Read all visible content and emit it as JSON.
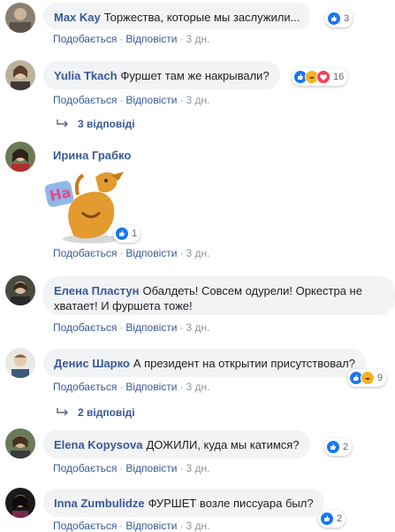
{
  "comments": [
    {
      "name": "Max Kay",
      "text": "Торжества, которые мы заслужили...",
      "reaction_count": "3",
      "actions": {
        "like": "Подобається",
        "reply": "Відповісти",
        "time": "3 дн."
      }
    },
    {
      "name": "Yulia Tkach",
      "text": "Фуршет там же накрывали?",
      "reaction_count": "16",
      "actions": {
        "like": "Подобається",
        "reply": "Відповісти",
        "time": "3 дн."
      },
      "replies": "3 відповіді"
    },
    {
      "name": "Ирина Грабко",
      "sticker_text": "Ha",
      "reaction_count": "1",
      "actions": {
        "like": "Подобається",
        "reply": "Відповісти",
        "time": "3 дн."
      }
    },
    {
      "name": "Елена Пластун",
      "text": "Обалдеть! Совсем одурели! Оркестра не хватает! И фуршета тоже!",
      "actions": {
        "like": "Подобається",
        "reply": "Відповісти",
        "time": "3 дн."
      }
    },
    {
      "name": "Денис Шарко",
      "text": "А президент на открытии присутствовал?",
      "reaction_count": "9",
      "actions": {
        "like": "Подобається",
        "reply": "Відповісти",
        "time": "3 дн."
      },
      "replies": "2 відповіді"
    },
    {
      "name": "Elena Kopysova",
      "text": "ДОЖИЛИ, куда мы катимся?",
      "reaction_count": "2",
      "actions": {
        "like": "Подобається",
        "reply": "Відповісти",
        "time": "3 дн."
      }
    },
    {
      "name": "Inna Zumbulidze",
      "text": "ФУРШЕТ возле писсуара был?",
      "reaction_count": "2",
      "actions": {
        "like": "Подобається",
        "reply": "Відповісти",
        "time": "3 дн."
      }
    }
  ],
  "colors": {
    "link": "#385898",
    "like": "#1877f2",
    "haha": "#f7b125",
    "love": "#f33e58",
    "bubble": "#f2f3f5"
  }
}
